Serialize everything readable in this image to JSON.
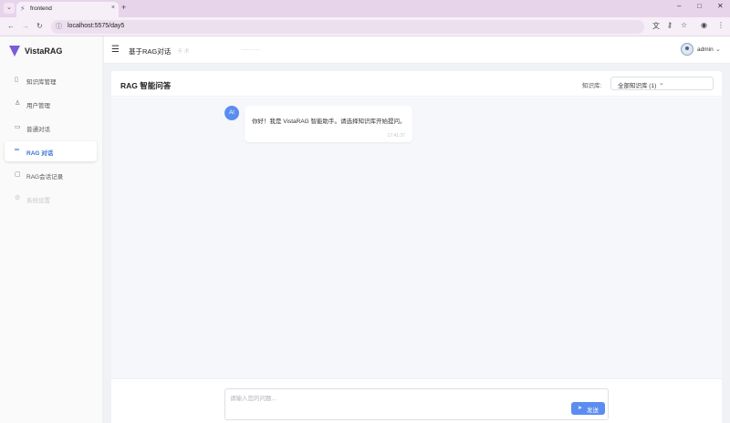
{
  "browser": {
    "tab_title": "frontend",
    "tab_close": "×",
    "new_tab": "+",
    "url": "localhost:5575/day5",
    "win_min": "–",
    "win_max": "□",
    "win_close": "✕",
    "menu_glyph": "⌄"
  },
  "sidebar": {
    "brand": "VistaRAG",
    "items": [
      {
        "label": "知识库管理",
        "icon": "document-icon"
      },
      {
        "label": "用户管理",
        "icon": "user-icon"
      },
      {
        "label": "普通对话",
        "icon": "monitor-icon"
      },
      {
        "label": "RAG 对话",
        "icon": "link-icon"
      },
      {
        "label": "RAG会话记录",
        "icon": "chat-icon"
      },
      {
        "label": "系统设置",
        "icon": "gear-icon"
      }
    ],
    "active_index": 3
  },
  "topbar": {
    "title": "基于RAG对话",
    "faded_1": "卡 术",
    "faded_2": "—— ——",
    "user": "admin"
  },
  "panel": {
    "title": "RAG 智能问答",
    "kb_label": "知识库:",
    "kb_value": "全部知识库 (1)"
  },
  "messages": [
    {
      "role": "AI",
      "text": "你好！我是 VistaRAG 智能助手。请选择知识库开始提问。",
      "time": "17:41:37"
    }
  ],
  "input": {
    "placeholder": "请输入您的问题...",
    "send_label": "发送"
  },
  "colors": {
    "accent": "#5b8df0",
    "active_menu_text": "#3a6fd8",
    "tabbar_bg": "#e8d4ea"
  }
}
